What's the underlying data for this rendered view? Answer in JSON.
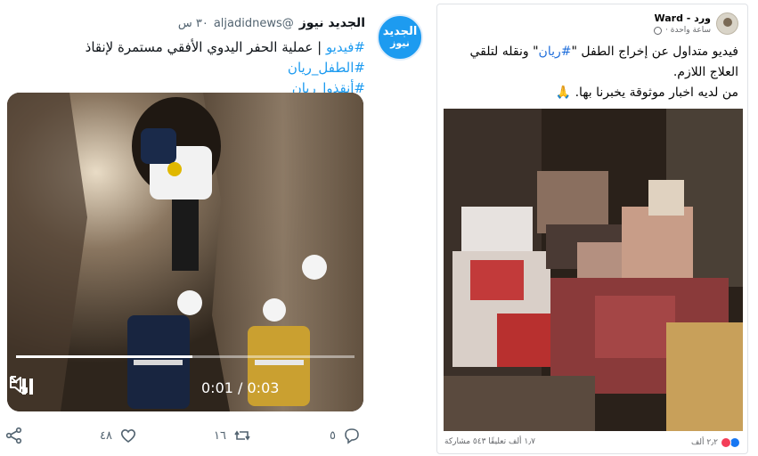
{
  "tweet": {
    "avatar_line1": "الجديد",
    "avatar_line2": "نيوز",
    "display_name": "الجديد نيوز",
    "handle": "@aljadidnews",
    "time": "٣٠ س",
    "text_prefix_hashtag": "#فيديو",
    "text_body": " | عملية الحفر اليدوي الأفقي مستمرة لإنقاذ ",
    "hashtag_child": "#الطفل_ريان",
    "hashtag_save": "#أنقذوا_ريان",
    "video": {
      "time_readout": "0:01 / 0:03",
      "progress_fraction": 0.52
    },
    "actions": {
      "reply_count": "٥",
      "retweet_count": "١٦",
      "like_count": "٤٨"
    },
    "colors": {
      "accent": "#1d9bf0",
      "muted": "#536471"
    }
  },
  "facebook": {
    "author": "ورد - Ward",
    "timestamp": "ساعة واحدة ·",
    "text_part1": "فيديو متداول عن إخراج الطفل \"",
    "hashtag": "#ريان",
    "text_part2": "\" ونقله لتلقي العلاج اللازم.",
    "text_line3": "من لديه اخبار موثوقة يخبرنا بها. 🙏",
    "reaction_count": "٢٫٢ ألف",
    "stats": "١٫٧ ألف تعليقًا ٥٤٣ مشاركة",
    "colors": {
      "link": "#216fdb",
      "muted": "#65676b"
    }
  },
  "icons": {
    "pause": "pause-icon",
    "volume": "volume-icon",
    "expand": "expand-icon",
    "reply": "reply-icon",
    "retweet": "retweet-icon",
    "like": "heart-icon",
    "share": "share-icon"
  }
}
